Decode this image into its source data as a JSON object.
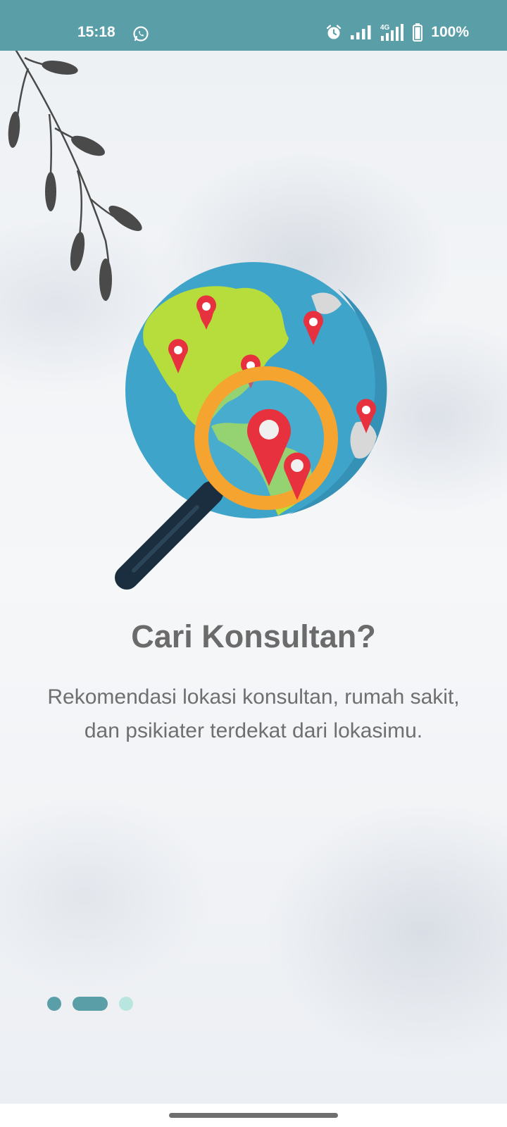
{
  "status_bar": {
    "time": "15:18",
    "battery": "100%",
    "network_label": "4G",
    "icons": [
      "whatsapp-icon",
      "alarm-icon",
      "signal-icon",
      "signal-4g-icon",
      "battery-icon"
    ]
  },
  "onboarding": {
    "title": "Cari Konsultan?",
    "description": "Rekomendasi lokasi konsultan, rumah sakit, dan psikiater terdekat dari lokasimu."
  },
  "pager": {
    "total": 3,
    "current": 2,
    "dots": [
      {
        "state": "inactive",
        "color": "#5a9ea8"
      },
      {
        "state": "active",
        "color": "#5a9ea8"
      },
      {
        "state": "inactive",
        "color": "#b8e6df"
      }
    ]
  },
  "colors": {
    "status_bar": "#5a9ea8",
    "title_text": "#6b6b6b",
    "ocean": "#3fa4c9",
    "land": "#b6dd3c",
    "magnifier_ring": "#f5a42f",
    "magnifier_handle": "#1a2e40",
    "pin": "#e8313f"
  }
}
